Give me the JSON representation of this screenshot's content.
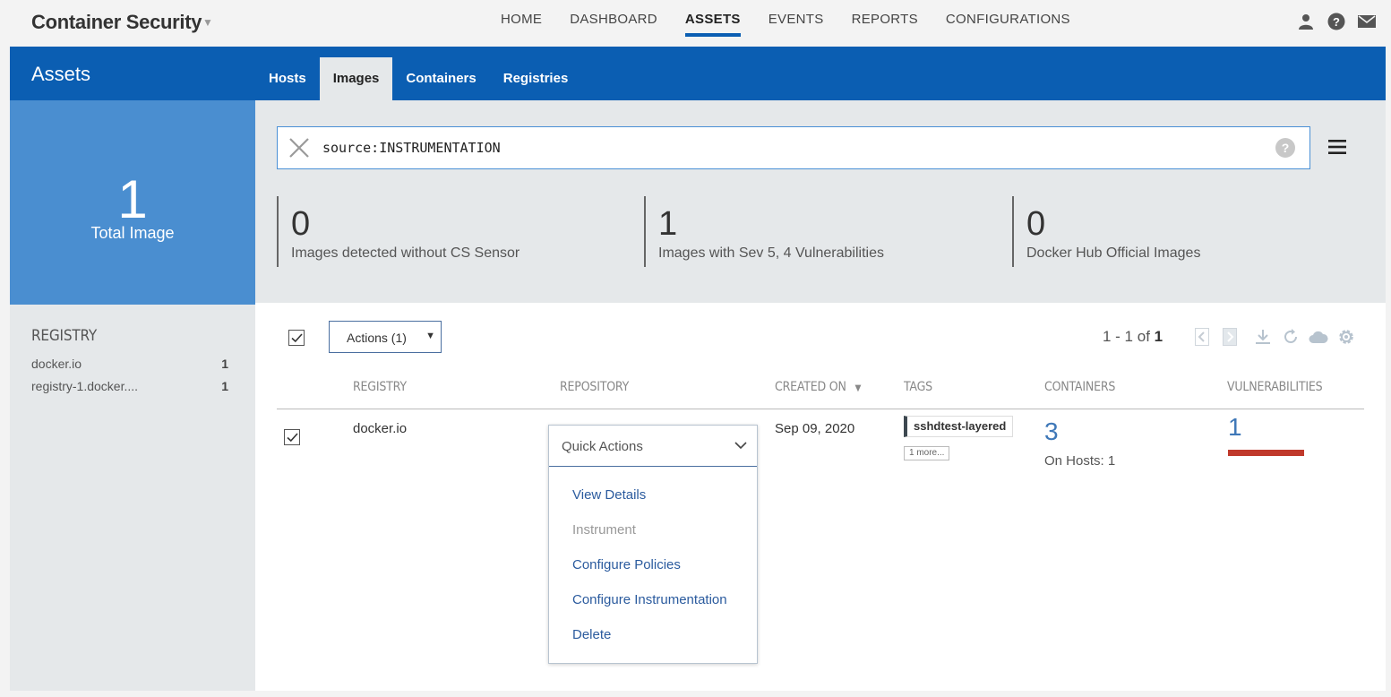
{
  "app": {
    "title": "Container Security",
    "caret": "▼"
  },
  "nav": {
    "items": [
      "HOME",
      "DASHBOARD",
      "ASSETS",
      "EVENTS",
      "REPORTS",
      "CONFIGURATIONS"
    ],
    "active": "ASSETS"
  },
  "top_icons": [
    "user-icon",
    "help-icon",
    "mail-icon"
  ],
  "band": {
    "title": "Assets",
    "tabs": [
      "Hosts",
      "Images",
      "Containers",
      "Registries"
    ],
    "active_tab": "Images"
  },
  "total": {
    "count": "1",
    "label": "Total Image"
  },
  "registry_panel": {
    "title": "REGISTRY",
    "items": [
      {
        "name": "docker.io",
        "count": "1"
      },
      {
        "name": "registry-1.docker....",
        "count": "1"
      }
    ]
  },
  "search": {
    "query": "source:INSTRUMENTATION",
    "help": "?"
  },
  "stats": [
    {
      "value": "0",
      "label": "Images detected without CS Sensor"
    },
    {
      "value": "1",
      "label": "Images with Sev 5, 4 Vulnerabilities"
    },
    {
      "value": "0",
      "label": "Docker Hub Official Images"
    }
  ],
  "toolbar": {
    "actions_label": "Actions (1)",
    "actions_arrow": "▼",
    "pager_range": "1 - 1 of",
    "pager_total": "1"
  },
  "table": {
    "headers": {
      "registry": "REGISTRY",
      "repository": "REPOSITORY",
      "created_on": "CREATED ON",
      "sort_arrow": "▼",
      "tags": "TAGS",
      "containers": "CONTAINERS",
      "vulnerabilities": "VULNERABILITIES"
    },
    "rows": [
      {
        "registry": "docker.io",
        "created_on": "Sep 09, 2020",
        "tag": "sshdtest-layered",
        "more_tags": "1 more...",
        "containers": "3",
        "on_hosts": "On Hosts: 1",
        "vulnerabilities": "1",
        "vuln_color": "#c0392b"
      }
    ]
  },
  "quick_actions": {
    "label": "Quick Actions",
    "items": [
      {
        "label": "View Details",
        "enabled": true
      },
      {
        "label": "Instrument",
        "enabled": false
      },
      {
        "label": "Configure Policies",
        "enabled": true
      },
      {
        "label": "Configure Instrumentation",
        "enabled": true
      },
      {
        "label": "Delete",
        "enabled": true
      }
    ]
  },
  "colors": {
    "brand_blue": "#0b5eb2",
    "total_box": "#4a8ed0",
    "link": "#2b5b9e"
  }
}
